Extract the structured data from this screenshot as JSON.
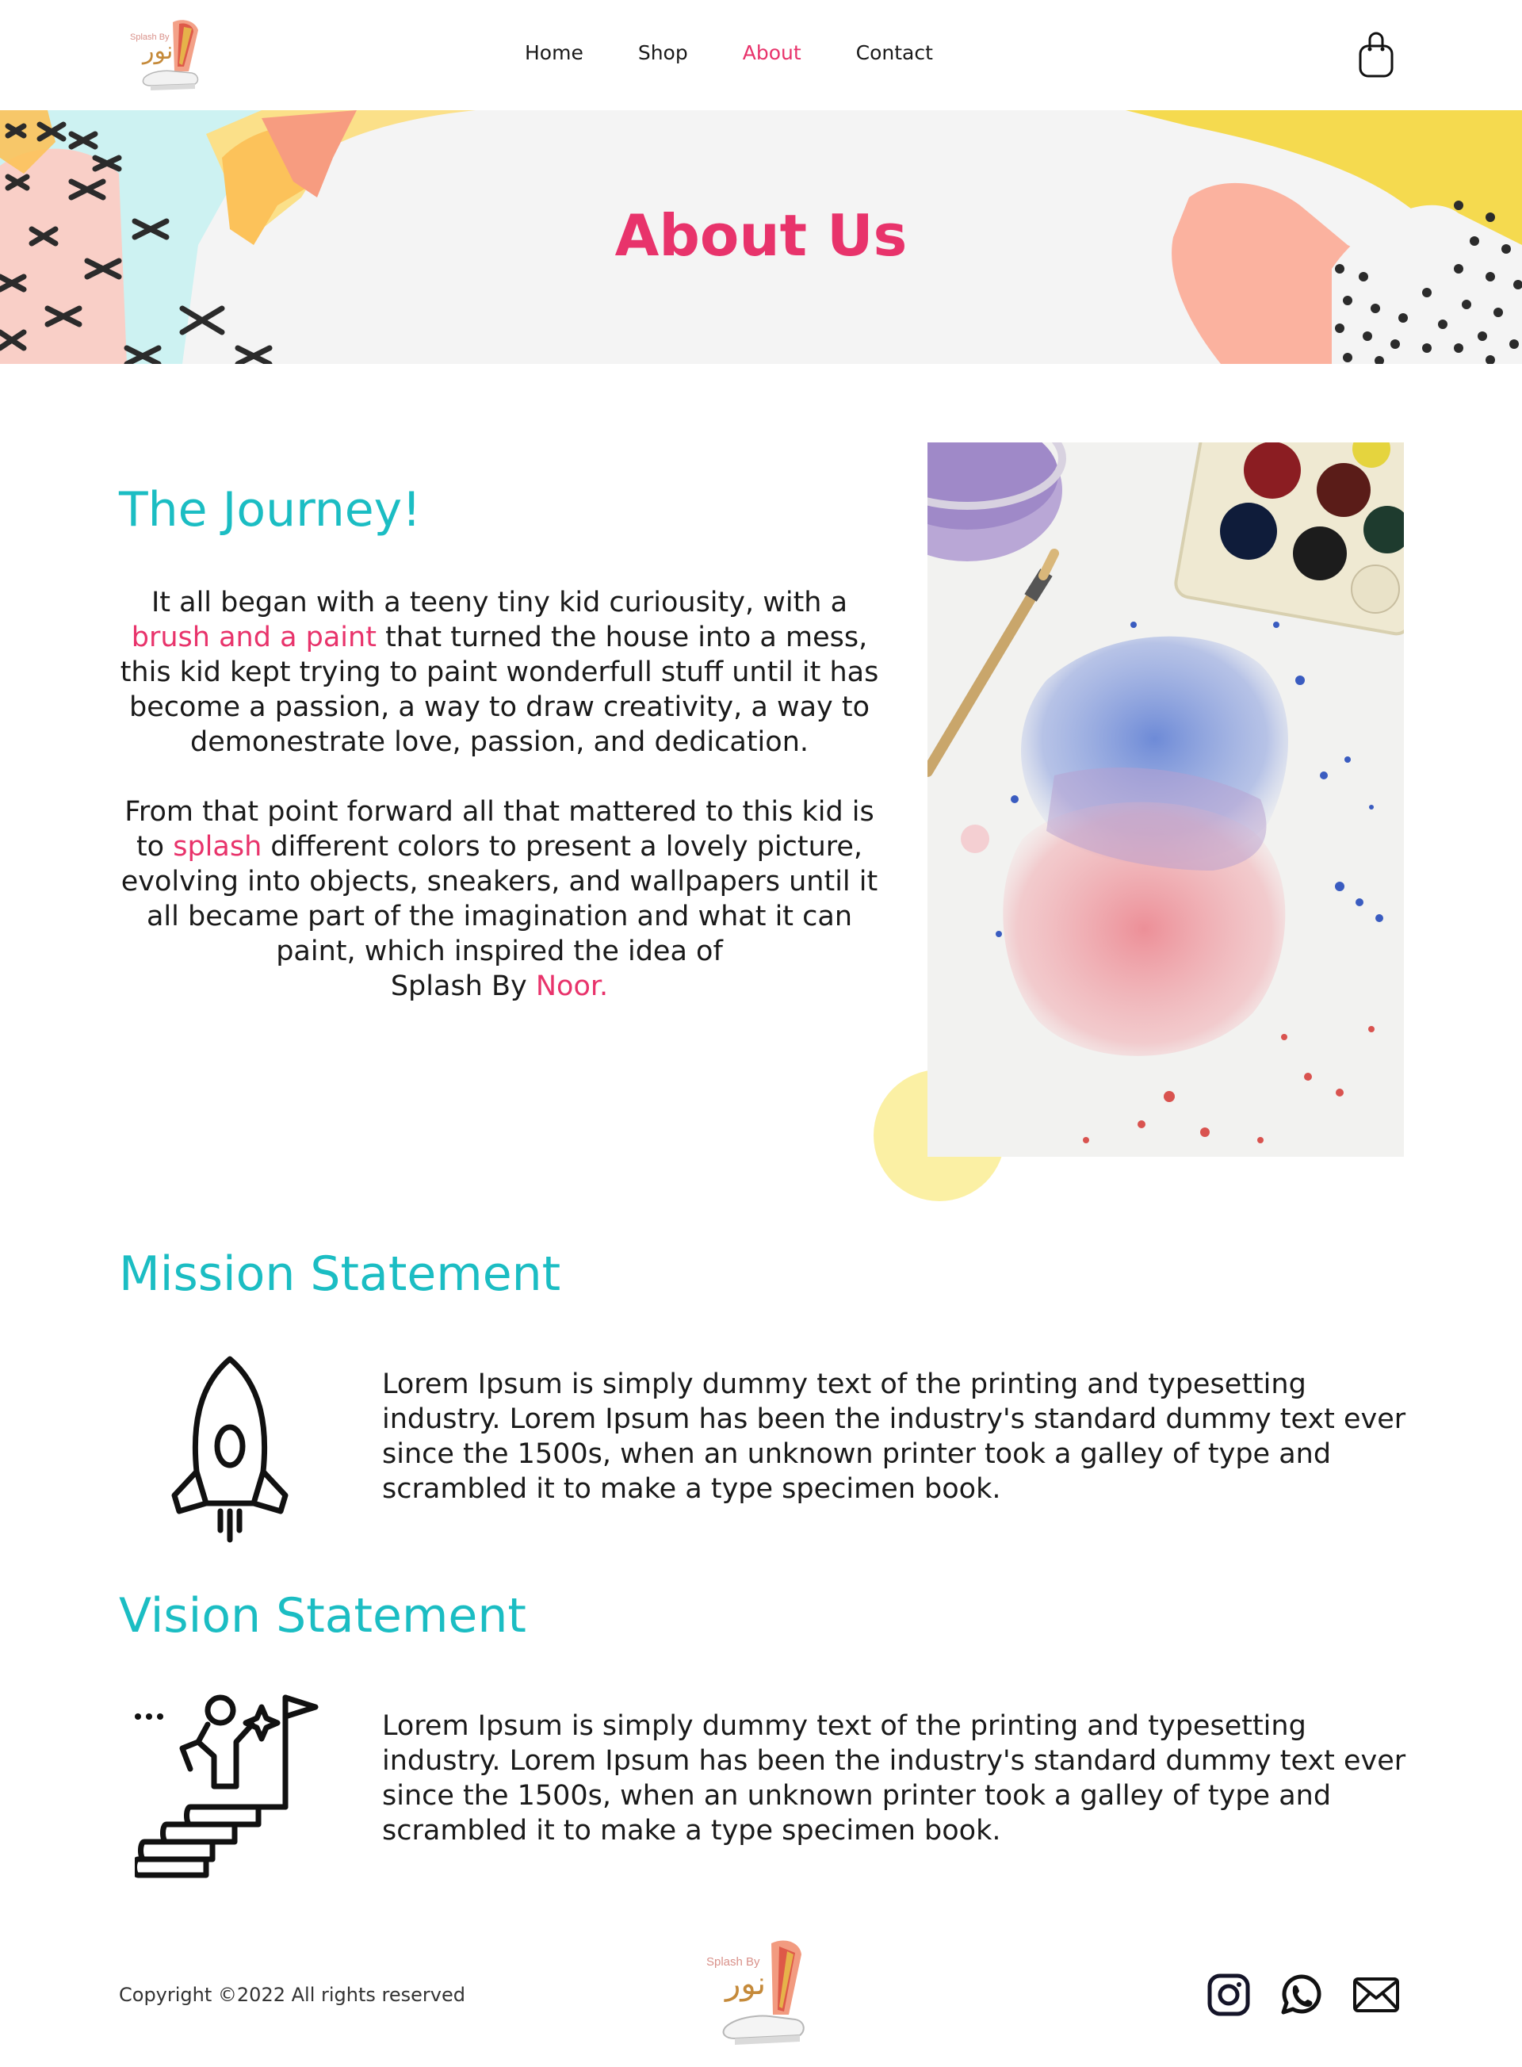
{
  "brand": {
    "logo_text": "Splash By",
    "logo_arabic": "نور"
  },
  "nav": {
    "items": [
      {
        "label": "Home"
      },
      {
        "label": "Shop"
      },
      {
        "label": "About"
      },
      {
        "label": "Contact"
      }
    ],
    "active": "About",
    "cart_icon": "shopping-bag-icon"
  },
  "hero": {
    "title": "About Us"
  },
  "journey": {
    "title": "The Journey!",
    "p1_a": "It all began with a teeny tiny kid curiousity, with a ",
    "p1_highlight": "brush and a paint",
    "p1_b": " that turned the house into a mess, this kid kept trying to paint wonderfull stuff until it has become a passion, a way to draw creativity, a way to demonestrate love, passion, and dedication.",
    "p2_a": "From that point forward all that mattered to this kid is to ",
    "p2_highlight": "splash",
    "p2_b": " different colors to present a lovely picture, evolving into objects, sneakers, and wallpapers until it all became part of the imagination and what it can paint, which inspired the idea of",
    "p2_brand": "Splash By ",
    "p2_brand_highlight": "Noor."
  },
  "mission": {
    "title": "Mission Statement",
    "icon": "rocket-icon",
    "text": "Lorem Ipsum is simply dummy text of the printing and typesetting industry. Lorem Ipsum has been the industry's standard dummy text ever since the 1500s, when an unknown printer took a galley of type and scrambled it to make a type specimen book."
  },
  "vision": {
    "title": "Vision Statement",
    "icon": "stairs-goal-icon",
    "text": "Lorem Ipsum is simply dummy text of the printing and typesetting industry. Lorem Ipsum has been the industry's standard dummy text ever since the 1500s, when an unknown printer took a galley of type and scrambled it to make a type specimen book."
  },
  "footer": {
    "copyright": "Copyright ©2022 All rights reserved",
    "social": [
      "instagram-icon",
      "whatsapp-icon",
      "mail-icon"
    ]
  },
  "colors": {
    "accent_pink": "#e8336b",
    "accent_teal": "#1bbdc3",
    "yellow": "#fbf0a4"
  }
}
